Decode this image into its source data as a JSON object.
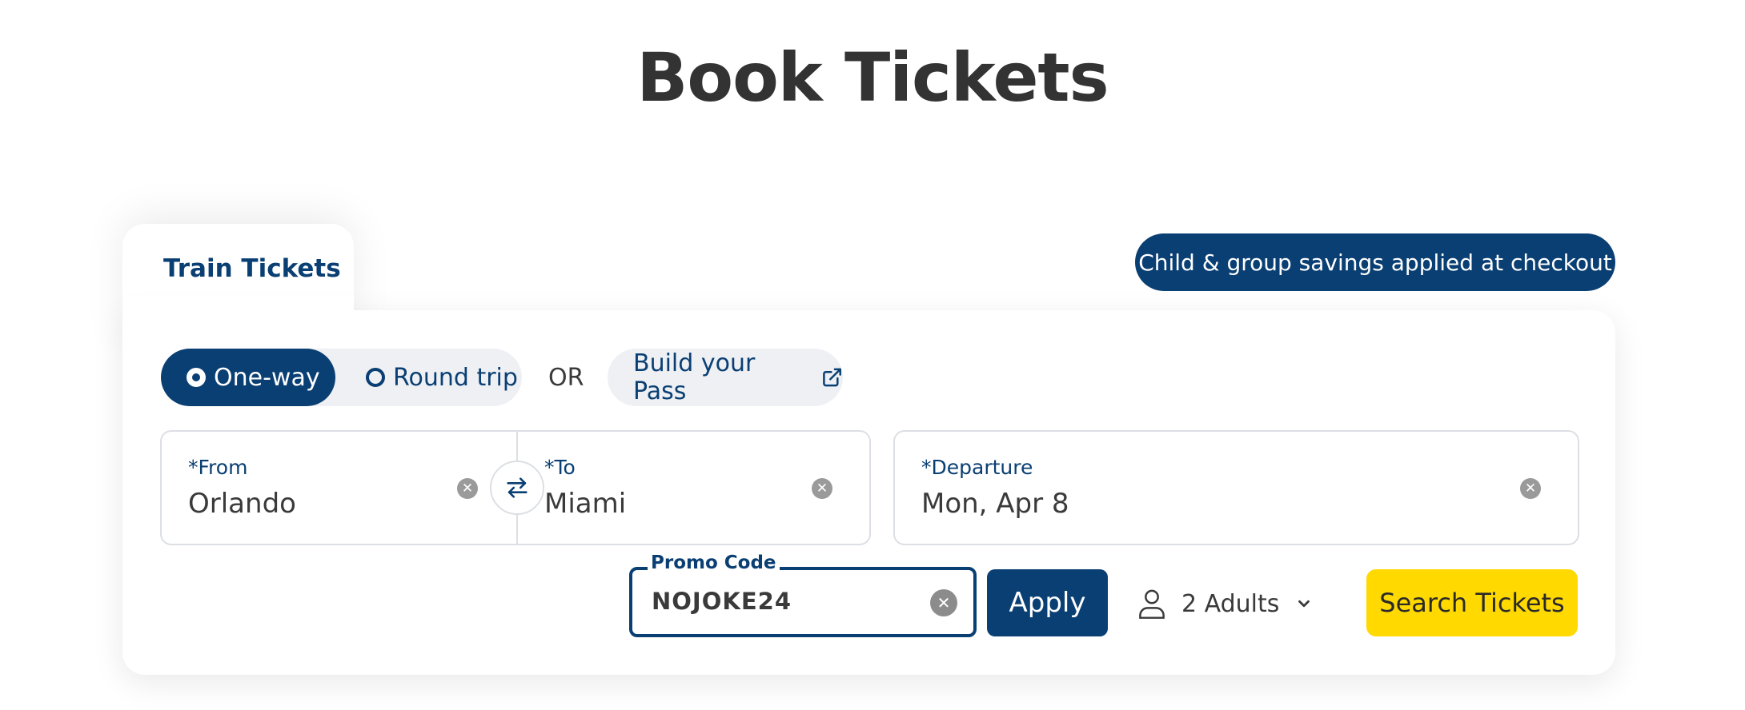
{
  "page": {
    "title": "Book Tickets"
  },
  "tab": {
    "label": "Train Tickets"
  },
  "badge": {
    "text": "Child & group savings applied at checkout"
  },
  "trip_type": {
    "options": [
      {
        "label": "One-way",
        "selected": true
      },
      {
        "label": "Round trip",
        "selected": false
      }
    ],
    "or_text": "OR",
    "pass_label": "Build your Pass"
  },
  "route": {
    "from_label": "*From",
    "from_value": "Orlando",
    "to_label": "*To",
    "to_value": "Miami"
  },
  "departure": {
    "label": "*Departure",
    "value": "Mon, Apr 8"
  },
  "promo": {
    "label": "Promo Code",
    "value": "NOJOKE24",
    "apply_label": "Apply"
  },
  "passengers": {
    "label": "2 Adults"
  },
  "search": {
    "label": "Search Tickets"
  },
  "icons": {
    "clear": "close-circle-icon",
    "swap": "swap-arrows-icon",
    "external": "external-link-icon",
    "person": "person-icon",
    "chevron": "chevron-down-icon"
  },
  "colors": {
    "brand": "#0a3f73",
    "accent": "#ffd900",
    "toggle_bg": "#eef0f4",
    "border": "#dcdfe4"
  }
}
